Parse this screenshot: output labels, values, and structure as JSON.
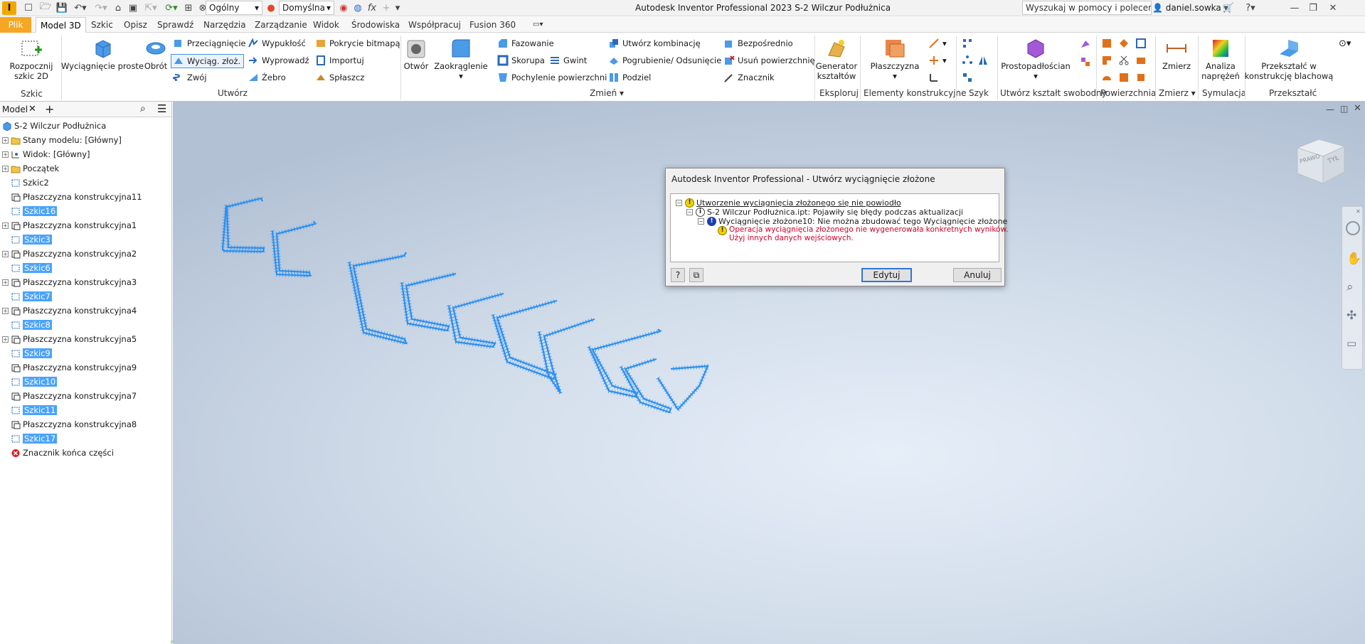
{
  "app": {
    "logo": "I",
    "window_title": "Autodesk Inventor Professional 2023   S-2 Wilczur Podłużnica"
  },
  "quick_access": {
    "combo_general": "Ogólny",
    "combo_default": "Domyślna"
  },
  "search": {
    "placeholder": "Wyszukaj w pomocy i polecenia..."
  },
  "user": {
    "name": "daniel.sowka"
  },
  "tabs": [
    "Plik",
    "Model 3D",
    "Szkic",
    "Opisz",
    "Sprawdź",
    "Narzędzia",
    "Zarządzanie",
    "Widok",
    "Środowiska",
    "Współpracuj",
    "Fusion 360"
  ],
  "ribbon": {
    "sketch": {
      "start2d": "Rozpocznij",
      "start2d_2": "szkic 2D",
      "group": "Szkic"
    },
    "create": {
      "extrude": "Wyciągnięcie proste",
      "revolve": "Obrót",
      "sweep": "Przeciągnięcie",
      "loft": "Wyciąg. złoż.",
      "coil": "Zwój",
      "emboss": "Wypukłość",
      "derive": "Wyprowadź",
      "rib": "Żebro",
      "decal": "Pokrycie bitmapą",
      "import": "Importuj",
      "unwrap": "Spłaszcz",
      "group": "Utwórz"
    },
    "modify": {
      "hole": "Otwór",
      "fillet": "Zaokrąglenie",
      "chamfer": "Fazowanie",
      "shell": "Skorupa",
      "thread": "Gwint",
      "draft": "Pochylenie powierzchni",
      "combine": "Utwórz kombinację",
      "thicken": "Pogrubienie/ Odsunięcie",
      "split": "Podziel",
      "direct": "Bezpośrednio",
      "delete_face": "Usuń powierzchnię",
      "marker": "Znacznik",
      "group": "Zmień"
    },
    "explore": {
      "shape_gen": "Generator",
      "shape_gen_2": "kształtów",
      "group": "Eksploruj"
    },
    "work": {
      "plane": "Płaszczyzna",
      "group": "Elementy konstrukcyjne"
    },
    "pattern": {
      "group": "Szyk"
    },
    "freeform": {
      "box": "Prostopadłościan",
      "group": "Utwórz kształt swobodny"
    },
    "surface": {
      "group": "Powierzchnia"
    },
    "measure": {
      "measure": "Zmierz",
      "group": "Zmierz"
    },
    "simulation": {
      "stress": "Analiza",
      "stress_2": "naprężeń",
      "group": "Symulacja"
    },
    "convert": {
      "sheet": "Przekształć w",
      "sheet_2": "konstrukcję blachową",
      "group": "Przekształć"
    }
  },
  "browser": {
    "tab": "Model",
    "nodes": [
      {
        "label": "S-2 Wilczur Podłużnica",
        "type": "part",
        "indent": 0
      },
      {
        "label": "Stany modelu: [Główny]",
        "type": "folder",
        "indent": 1,
        "exp": true
      },
      {
        "label": "Widok: [Główny]",
        "type": "view",
        "indent": 1,
        "exp": true
      },
      {
        "label": "Początek",
        "type": "folder",
        "indent": 1,
        "exp": true
      },
      {
        "label": "Szkic2",
        "type": "sketch",
        "indent": 1
      },
      {
        "label": "Płaszczyzna konstrukcyjna11",
        "type": "plane",
        "indent": 1
      },
      {
        "label": "Szkic16",
        "type": "sketch",
        "indent": 1,
        "hl": true
      },
      {
        "label": "Płaszczyzna konstrukcyjna1",
        "type": "plane",
        "indent": 1,
        "exp": true
      },
      {
        "label": "Szkic3",
        "type": "sketch",
        "indent": 1,
        "hl": true
      },
      {
        "label": "Płaszczyzna konstrukcyjna2",
        "type": "plane",
        "indent": 1,
        "exp": true
      },
      {
        "label": "Szkic6",
        "type": "sketch",
        "indent": 1,
        "hl": true
      },
      {
        "label": "Płaszczyzna konstrukcyjna3",
        "type": "plane",
        "indent": 1,
        "exp": true
      },
      {
        "label": "Szkic7",
        "type": "sketch",
        "indent": 1,
        "hl": true
      },
      {
        "label": "Płaszczyzna konstrukcyjna4",
        "type": "plane",
        "indent": 1,
        "exp": true
      },
      {
        "label": "Szkic8",
        "type": "sketch",
        "indent": 1,
        "hl": true
      },
      {
        "label": "Płaszczyzna konstrukcyjna5",
        "type": "plane",
        "indent": 1,
        "exp": true
      },
      {
        "label": "Szkic9",
        "type": "sketch",
        "indent": 1,
        "hl": true
      },
      {
        "label": "Płaszczyzna konstrukcyjna9",
        "type": "plane",
        "indent": 1
      },
      {
        "label": "Szkic10",
        "type": "sketch",
        "indent": 1,
        "hl": true
      },
      {
        "label": "Płaszczyzna konstrukcyjna7",
        "type": "plane",
        "indent": 1
      },
      {
        "label": "Szkic11",
        "type": "sketch",
        "indent": 1,
        "hl": true
      },
      {
        "label": "Płaszczyzna konstrukcyjna8",
        "type": "plane",
        "indent": 1
      },
      {
        "label": "Szkic17",
        "type": "sketch",
        "indent": 1,
        "hl": true
      },
      {
        "label": "Znacznik końca części",
        "type": "end",
        "indent": 1
      }
    ]
  },
  "viewcube": {
    "front": "PRAWO",
    "right": "TYŁ"
  },
  "dialog": {
    "title": "Autodesk Inventor Professional - Utwórz wyciągnięcie złożone",
    "msg1": "Utworzenie wyciągnięcia złożonego się nie powiodło",
    "msg2": "S-2 Wilczur Podłużnica.ipt: Pojawiły się błędy podczas aktualizacji",
    "msg3": "Wyciągnięcie złożone10: Nie można zbudować tego Wyciągnięcie złożone",
    "msg4a": "Operacja wyciągnięcia złożonego nie wygenerowała konkretnych wyników.",
    "msg4b": "Użyj innych danych wejściowych.",
    "edit": "Edytuj",
    "cancel": "Anuluj"
  },
  "colors": {
    "accent": "#f5a623",
    "sketch": "#2b8ff0",
    "error": "#d0002a"
  }
}
